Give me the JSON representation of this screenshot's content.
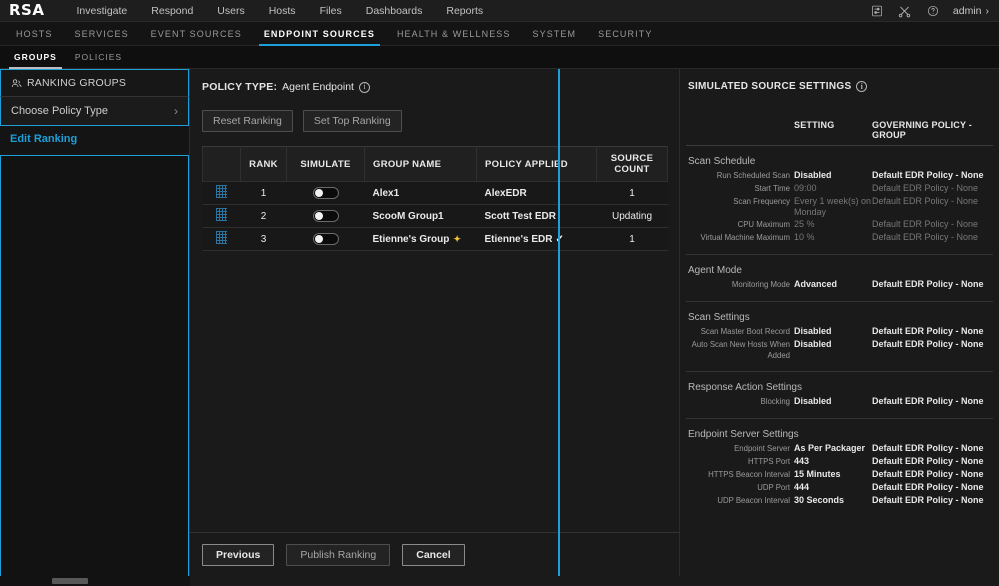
{
  "brand": {
    "logo": "RSA"
  },
  "topnav": {
    "items": [
      {
        "label": "Investigate"
      },
      {
        "label": "Respond"
      },
      {
        "label": "Users"
      },
      {
        "label": "Hosts"
      },
      {
        "label": "Files"
      },
      {
        "label": "Dashboards"
      },
      {
        "label": "Reports"
      }
    ],
    "icons": [
      {
        "name": "tasks-icon",
        "glyph": "☷"
      },
      {
        "name": "tools-icon",
        "glyph": "✂"
      },
      {
        "name": "help-icon",
        "glyph": "?"
      }
    ],
    "user": {
      "label": "admin",
      "chevron": "›"
    }
  },
  "subnav": {
    "items": [
      {
        "label": "HOSTS",
        "active": false
      },
      {
        "label": "SERVICES",
        "active": false
      },
      {
        "label": "EVENT SOURCES",
        "active": false
      },
      {
        "label": "ENDPOINT SOURCES",
        "active": true
      },
      {
        "label": "HEALTH & WELLNESS",
        "active": false
      },
      {
        "label": "SYSTEM",
        "active": false
      },
      {
        "label": "SECURITY",
        "active": false
      }
    ]
  },
  "tabs": {
    "items": [
      {
        "label": "GROUPS",
        "active": true
      },
      {
        "label": "POLICIES",
        "active": false
      }
    ]
  },
  "sidebar": {
    "header": "RANKING GROUPS",
    "policy_type_selector": "Choose Policy Type",
    "chevron": "›",
    "edit_ranking": "Edit Ranking"
  },
  "main": {
    "policy_type_label": "POLICY TYPE:",
    "policy_type_value": "Agent Endpoint",
    "buttons": {
      "reset_ranking": "Reset Ranking",
      "set_top_ranking": "Set Top Ranking"
    },
    "table": {
      "columns": [
        "",
        "RANK",
        "SIMULATE",
        "GROUP NAME",
        "POLICY APPLIED",
        "SOURCE COUNT"
      ],
      "source_count_line1": "SOURCE",
      "source_count_line2": "COUNT",
      "rows": [
        {
          "rank": "1",
          "simulate": "off",
          "group_name": "Alex1",
          "group_badge": "",
          "policy_applied": "AlexEDR",
          "policy_check": "",
          "source_count": "1"
        },
        {
          "rank": "2",
          "simulate": "off",
          "group_name": "ScooM Group1",
          "group_badge": "",
          "policy_applied": "Scott Test EDR",
          "policy_check": "",
          "source_count": "Updating"
        },
        {
          "rank": "3",
          "simulate": "off",
          "group_name": "Etienne's Group",
          "group_badge": "✦",
          "policy_applied": "Etienne's EDR",
          "policy_check": "✓",
          "source_count": "1"
        }
      ]
    },
    "footer": {
      "previous": "Previous",
      "publish_ranking": "Publish Ranking",
      "cancel": "Cancel"
    }
  },
  "right_panel": {
    "title": "SIMULATED SOURCE SETTINGS",
    "col_setting": "SETTING",
    "col_governing": "GOVERNING POLICY - GROUP",
    "sections": [
      {
        "name": "Scan Schedule",
        "divided": false,
        "rows": [
          {
            "label": "Run Scheduled Scan",
            "setting": "Disabled",
            "governing": "Default EDR Policy - None",
            "dim": false
          },
          {
            "label": "Start Time",
            "setting": "09:00",
            "governing": "Default EDR Policy - None",
            "dim": true
          },
          {
            "label": "Scan Frequency",
            "setting": "Every 1 week(s) on Monday",
            "governing": "Default EDR Policy - None",
            "dim": true
          },
          {
            "label": "CPU Maximum",
            "setting": "25 %",
            "governing": "Default EDR Policy - None",
            "dim": true
          },
          {
            "label": "Virtual Machine Maximum",
            "setting": "10 %",
            "governing": "Default EDR Policy - None",
            "dim": true
          }
        ]
      },
      {
        "name": "Agent Mode",
        "divided": true,
        "rows": [
          {
            "label": "Monitoring Mode",
            "setting": "Advanced",
            "governing": "Default EDR Policy - None",
            "dim": false
          }
        ]
      },
      {
        "name": "Scan Settings",
        "divided": true,
        "rows": [
          {
            "label": "Scan Master Boot Record",
            "setting": "Disabled",
            "governing": "Default EDR Policy - None",
            "dim": false
          },
          {
            "label": "Auto Scan New Hosts When Added",
            "setting": "Disabled",
            "governing": "Default EDR Policy - None",
            "dim": false
          }
        ]
      },
      {
        "name": "Response Action Settings",
        "divided": true,
        "rows": [
          {
            "label": "Blocking",
            "setting": "Disabled",
            "governing": "Default EDR Policy - None",
            "dim": false
          }
        ]
      },
      {
        "name": "Endpoint Server Settings",
        "divided": true,
        "rows": [
          {
            "label": "Endpoint Server",
            "setting": "As Per Packager",
            "governing": "Default EDR Policy - None",
            "dim": false
          },
          {
            "label": "HTTPS Port",
            "setting": "443",
            "governing": "Default EDR Policy - None",
            "dim": false
          },
          {
            "label": "HTTPS Beacon Interval",
            "setting": "15 Minutes",
            "governing": "Default EDR Policy - None",
            "dim": false
          },
          {
            "label": "UDP Port",
            "setting": "444",
            "governing": "Default EDR Policy - None",
            "dim": false
          },
          {
            "label": "UDP Beacon Interval",
            "setting": "30 Seconds",
            "governing": "Default EDR Policy - None",
            "dim": false
          }
        ]
      }
    ]
  },
  "colors": {
    "accent": "#1d9fd9",
    "drag_handle": "#2f78a8",
    "badge": "#f2c230",
    "background": "#1a1a1a"
  }
}
